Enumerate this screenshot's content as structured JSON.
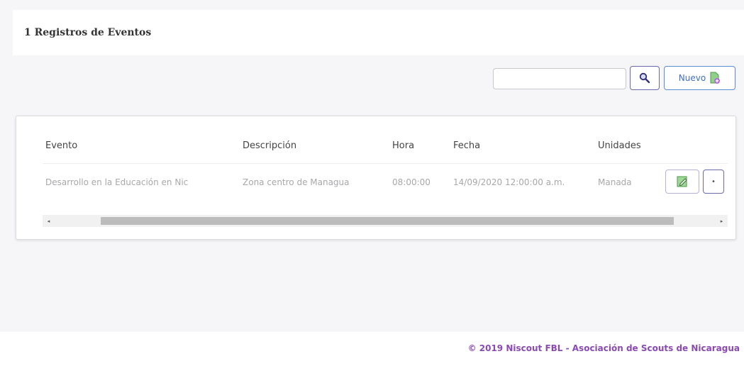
{
  "header": {
    "title": "1 Registros de Eventos"
  },
  "toolbar": {
    "search_value": "",
    "search_icon": "magnifier-icon",
    "new_label": "Nuevo",
    "new_icon": "add-document-icon"
  },
  "table": {
    "columns": [
      "Evento",
      "Descripción",
      "Hora",
      "Fecha",
      "Unidades"
    ],
    "rows": [
      {
        "evento": "Desarrollo en la Educación en Nic",
        "descripcion": "Zona centro de Managua",
        "hora": "08:00:00",
        "fecha": "14/09/2020 12:00:00 a.m.",
        "unidades": "Manada"
      }
    ],
    "row_actions": {
      "edit_icon": "edit-icon"
    },
    "scroll_arrows": {
      "left": "◂",
      "right": "▸"
    }
  },
  "footer": {
    "copyright": "© 2019 Niscout FBL - Asociación de Scouts de Nicaragua"
  },
  "colors": {
    "accent": "#8a4ab2",
    "button_blue": "#3f6fc4",
    "edit_green": "#5fb35a"
  }
}
